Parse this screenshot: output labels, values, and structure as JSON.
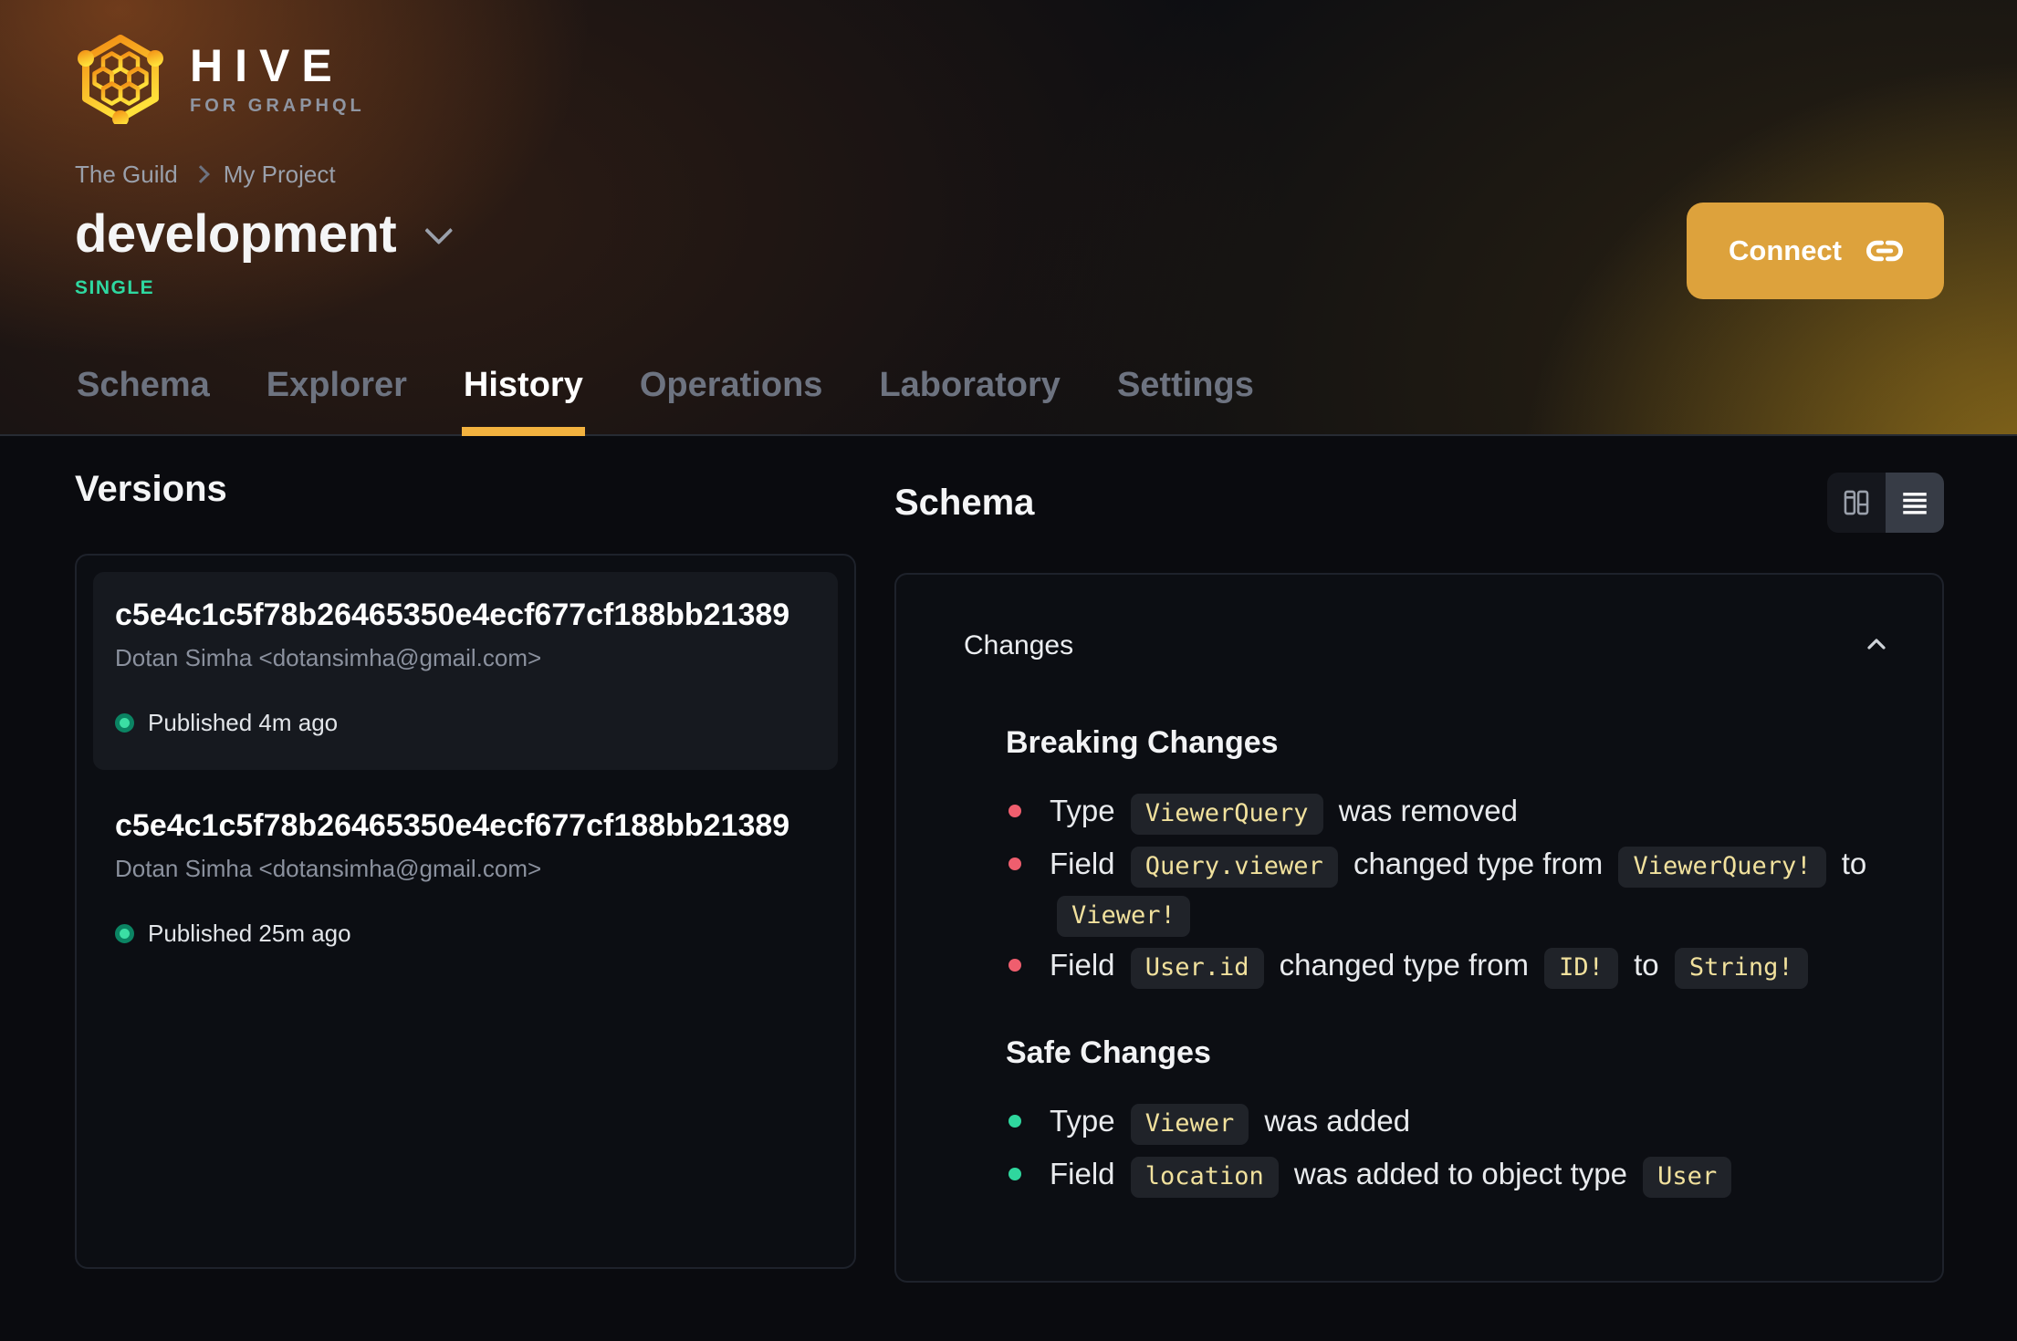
{
  "brand": {
    "name": "HIVE",
    "tagline": "FOR GRAPHQL"
  },
  "breadcrumb": {
    "items": [
      "The Guild",
      "My Project"
    ]
  },
  "project": {
    "name": "development",
    "badge": "SINGLE"
  },
  "header": {
    "connect_label": "Connect",
    "connect_icon": "link-icon"
  },
  "tabs": [
    {
      "label": "Schema",
      "active": false
    },
    {
      "label": "Explorer",
      "active": false
    },
    {
      "label": "History",
      "active": true
    },
    {
      "label": "Operations",
      "active": false
    },
    {
      "label": "Laboratory",
      "active": false
    },
    {
      "label": "Settings",
      "active": false
    }
  ],
  "versions": {
    "title": "Versions",
    "items": [
      {
        "hash": "c5e4c1c5f78b26465350e4ecf677cf188bb21389",
        "author": "Dotan Simha <dotansimha@gmail.com>",
        "status": "Published 4m ago",
        "selected": true
      },
      {
        "hash": "c5e4c1c5f78b26465350e4ecf677cf188bb21389",
        "author": "Dotan Simha <dotansimha@gmail.com>",
        "status": "Published 25m ago",
        "selected": false
      }
    ]
  },
  "schema": {
    "title": "Schema",
    "changes_label": "Changes",
    "view_modes": [
      "columns-view",
      "list-view"
    ],
    "active_view": "list-view",
    "sections": [
      {
        "title": "Breaking Changes",
        "kind": "breaking",
        "items": [
          [
            {
              "t": "text",
              "v": "Type "
            },
            {
              "t": "code",
              "v": "ViewerQuery"
            },
            {
              "t": "text",
              "v": " was removed"
            }
          ],
          [
            {
              "t": "text",
              "v": "Field "
            },
            {
              "t": "code",
              "v": "Query.viewer"
            },
            {
              "t": "text",
              "v": " changed type from "
            },
            {
              "t": "code",
              "v": "ViewerQuery!"
            },
            {
              "t": "text",
              "v": " to "
            },
            {
              "t": "code",
              "v": "Viewer!"
            }
          ],
          [
            {
              "t": "text",
              "v": "Field "
            },
            {
              "t": "code",
              "v": "User.id"
            },
            {
              "t": "text",
              "v": " changed type from "
            },
            {
              "t": "code",
              "v": "ID!"
            },
            {
              "t": "text",
              "v": " to "
            },
            {
              "t": "code",
              "v": "String!"
            }
          ]
        ]
      },
      {
        "title": "Safe Changes",
        "kind": "safe",
        "items": [
          [
            {
              "t": "text",
              "v": "Type "
            },
            {
              "t": "code",
              "v": "Viewer"
            },
            {
              "t": "text",
              "v": " was added"
            }
          ],
          [
            {
              "t": "text",
              "v": "Field "
            },
            {
              "t": "code",
              "v": "location"
            },
            {
              "t": "text",
              "v": " was added to object type "
            },
            {
              "t": "code",
              "v": "User"
            }
          ]
        ]
      }
    ]
  },
  "colors": {
    "accent_tab_underline": "#f2b23f",
    "connect_button": "#dda23c",
    "badge_green": "#2ed8a0",
    "breaking_bullet": "#ef5e6e",
    "safe_bullet": "#2fd79e",
    "code_chip_text": "#f1e19d"
  }
}
